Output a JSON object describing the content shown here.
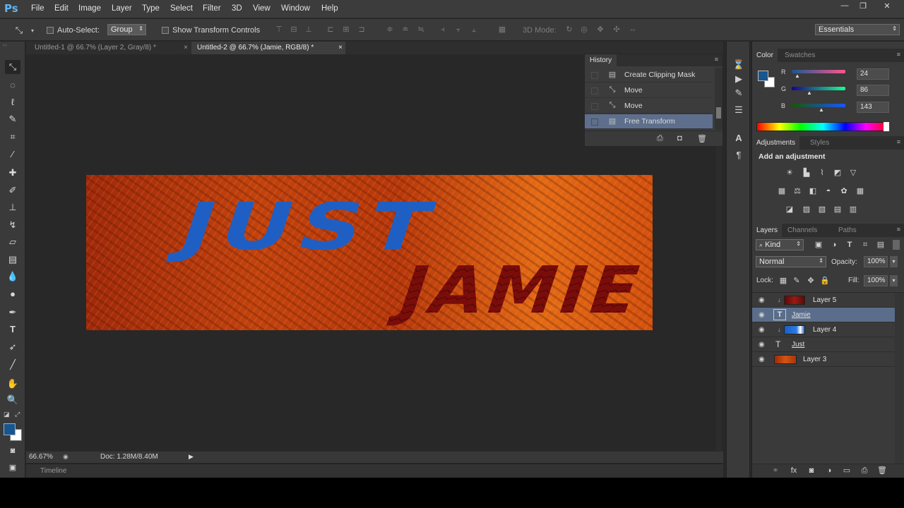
{
  "app": {
    "logo": "Ps"
  },
  "menu": [
    "File",
    "Edit",
    "Image",
    "Layer",
    "Type",
    "Select",
    "Filter",
    "3D",
    "View",
    "Window",
    "Help"
  ],
  "window_controls": {
    "minimize": "—",
    "restore": "❐",
    "close": "✕"
  },
  "options_bar": {
    "auto_select_label": "Auto-Select:",
    "auto_select_value": "Group",
    "show_transform_label": "Show Transform Controls",
    "mode_3d_label": "3D Mode:",
    "workspace": "Essentials"
  },
  "doc_tabs": [
    {
      "label": "Untitled-1 @ 66.7% (Layer 2, Gray/8) *",
      "close": "×"
    },
    {
      "label": "Untitled-2 @ 66.7% (Jamie, RGB/8) *",
      "close": "×"
    }
  ],
  "artwork": {
    "word1": "JUST",
    "word2": "JAMIE"
  },
  "status": {
    "zoom": "66.67%",
    "doc": "Doc: 1.28M/8.40M"
  },
  "timeline": {
    "label": "Timeline"
  },
  "history": {
    "title": "History",
    "items": [
      {
        "label": "Create Clipping Mask",
        "icon": "document-icon",
        "active": false
      },
      {
        "label": "Move",
        "icon": "move-icon",
        "active": false
      },
      {
        "label": "Move",
        "icon": "move-icon",
        "active": false
      },
      {
        "label": "Free Transform",
        "icon": "document-icon",
        "active": true
      }
    ]
  },
  "color_panel": {
    "tabs": [
      "Color",
      "Swatches"
    ],
    "r_label": "R",
    "r_value": "24",
    "g_label": "G",
    "g_value": "86",
    "b_label": "B",
    "b_value": "143",
    "foreground": "#18568f",
    "background": "#ffffff"
  },
  "adjustments": {
    "tabs": [
      "Adjustments",
      "Styles"
    ],
    "title": "Add an adjustment"
  },
  "layers_panel": {
    "tabs": [
      "Layers",
      "Channels",
      "Paths"
    ],
    "filter_kind": "Kind",
    "blend_mode": "Normal",
    "opacity_label": "Opacity:",
    "opacity_value": "100%",
    "lock_label": "Lock:",
    "fill_label": "Fill:",
    "fill_value": "100%",
    "layers": [
      {
        "name": "Layer 5",
        "kind": "clipped-image",
        "active": false
      },
      {
        "name": "Jamie",
        "kind": "text",
        "active": true
      },
      {
        "name": "Layer 4",
        "kind": "clipped-image",
        "active": false
      },
      {
        "name": "Just",
        "kind": "text",
        "active": false
      },
      {
        "name": "Layer 3",
        "kind": "image",
        "active": false
      }
    ]
  },
  "colors": {
    "accent_selection": "#5d6f8c",
    "text_blue": "#1f5fc4",
    "text_red": "#7a0d0a"
  }
}
